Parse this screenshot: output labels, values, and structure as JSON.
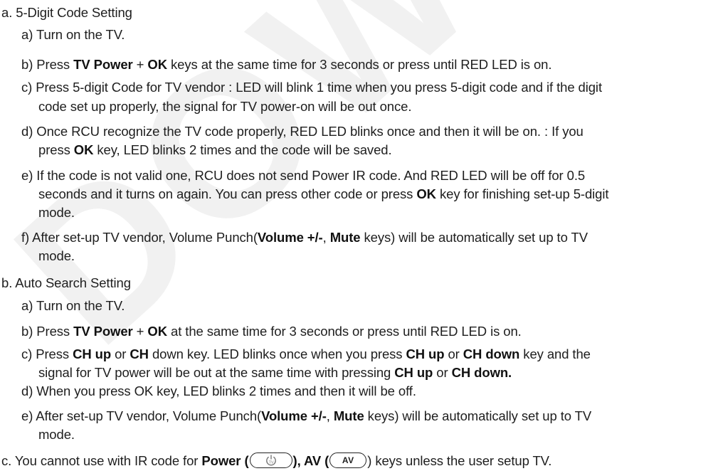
{
  "watermark": "DOWNLOAD",
  "section_a": {
    "heading": "a. 5-Digit Code Setting",
    "step_a": "a) Turn on the TV.",
    "step_b": {
      "pre": "b) Press ",
      "k1": "TV Power",
      "plus": " + ",
      "k2": "OK",
      "post": " keys at the same time for 3 seconds or press until RED LED is on."
    },
    "step_c": {
      "line1": "c) Press 5-digit Code for TV vendor :  LED will blink 1 time when you press 5-digit code and if the digit",
      "line2": "code set up properly, the signal for TV power-on will be out once."
    },
    "step_d": {
      "line1": "d) Once RCU recognize the TV code properly, RED LED blinks once and then it will be on. :  If you",
      "line2_pre": "press ",
      "line2_key": "OK",
      "line2_post": " key, LED blinks 2 times and the code will be saved."
    },
    "step_e": {
      "line1": "e) If the code is not valid one, RCU does not send Power IR code. And RED LED will be off for 0.5",
      "line2_pre": "seconds and it turns on again. You can press other code or press ",
      "line2_key": "OK",
      "line2_post": " key for finishing set-up 5-digit",
      "line3": "mode."
    },
    "step_f": {
      "line1_pre": "f) After set-up TV vendor, Volume Punch(",
      "line1_k1": "Volume +/-",
      "line1_mid": ", ",
      "line1_k2": "Mute",
      "line1_post": " keys) will be automatically set up to TV",
      "line2": "mode."
    }
  },
  "section_b": {
    "heading": "b. Auto Search Setting",
    "step_a": "a) Turn on the TV.",
    "step_b": {
      "pre": "b) Press ",
      "k1": "TV Power",
      "plus": " + ",
      "k2": "OK",
      "post": " at the same time for 3 seconds or press until RED LED is on."
    },
    "step_c": {
      "line1_pre": "c) Press ",
      "line1_k1": "CH up",
      "line1_or": " or ",
      "line1_k2": "CH",
      "line1_mid": " down key. LED blinks once when you press ",
      "line1_k3": "CH up",
      "line1_or2": " or ",
      "line1_k4": "CH down",
      "line1_post": " key and the",
      "line2_pre": "signal for TV power will be out at the same time with pressing ",
      "line2_k1": "CH up",
      "line2_or": " or ",
      "line2_k2": "CH down."
    },
    "step_d": "d) When you press OK key, LED blinks 2 times and then it will be off.",
    "step_e": {
      "line1_pre": "e) After set-up TV vendor, Volume Punch(",
      "line1_k1": "Volume +/-",
      "line1_mid": ", ",
      "line1_k2": "Mute",
      "line1_post": " keys) will be automatically set up to TV",
      "line2": "mode."
    }
  },
  "section_c": {
    "pre": "c. You cannot use with IR code for ",
    "power_label": "Power",
    "open1": " (",
    "close1": "), ",
    "av_label": "AV",
    "open2": " (",
    "av_key_text": "AV",
    "post": ") keys unless the user setup TV.",
    "power_icon": "tv-power-icon"
  }
}
